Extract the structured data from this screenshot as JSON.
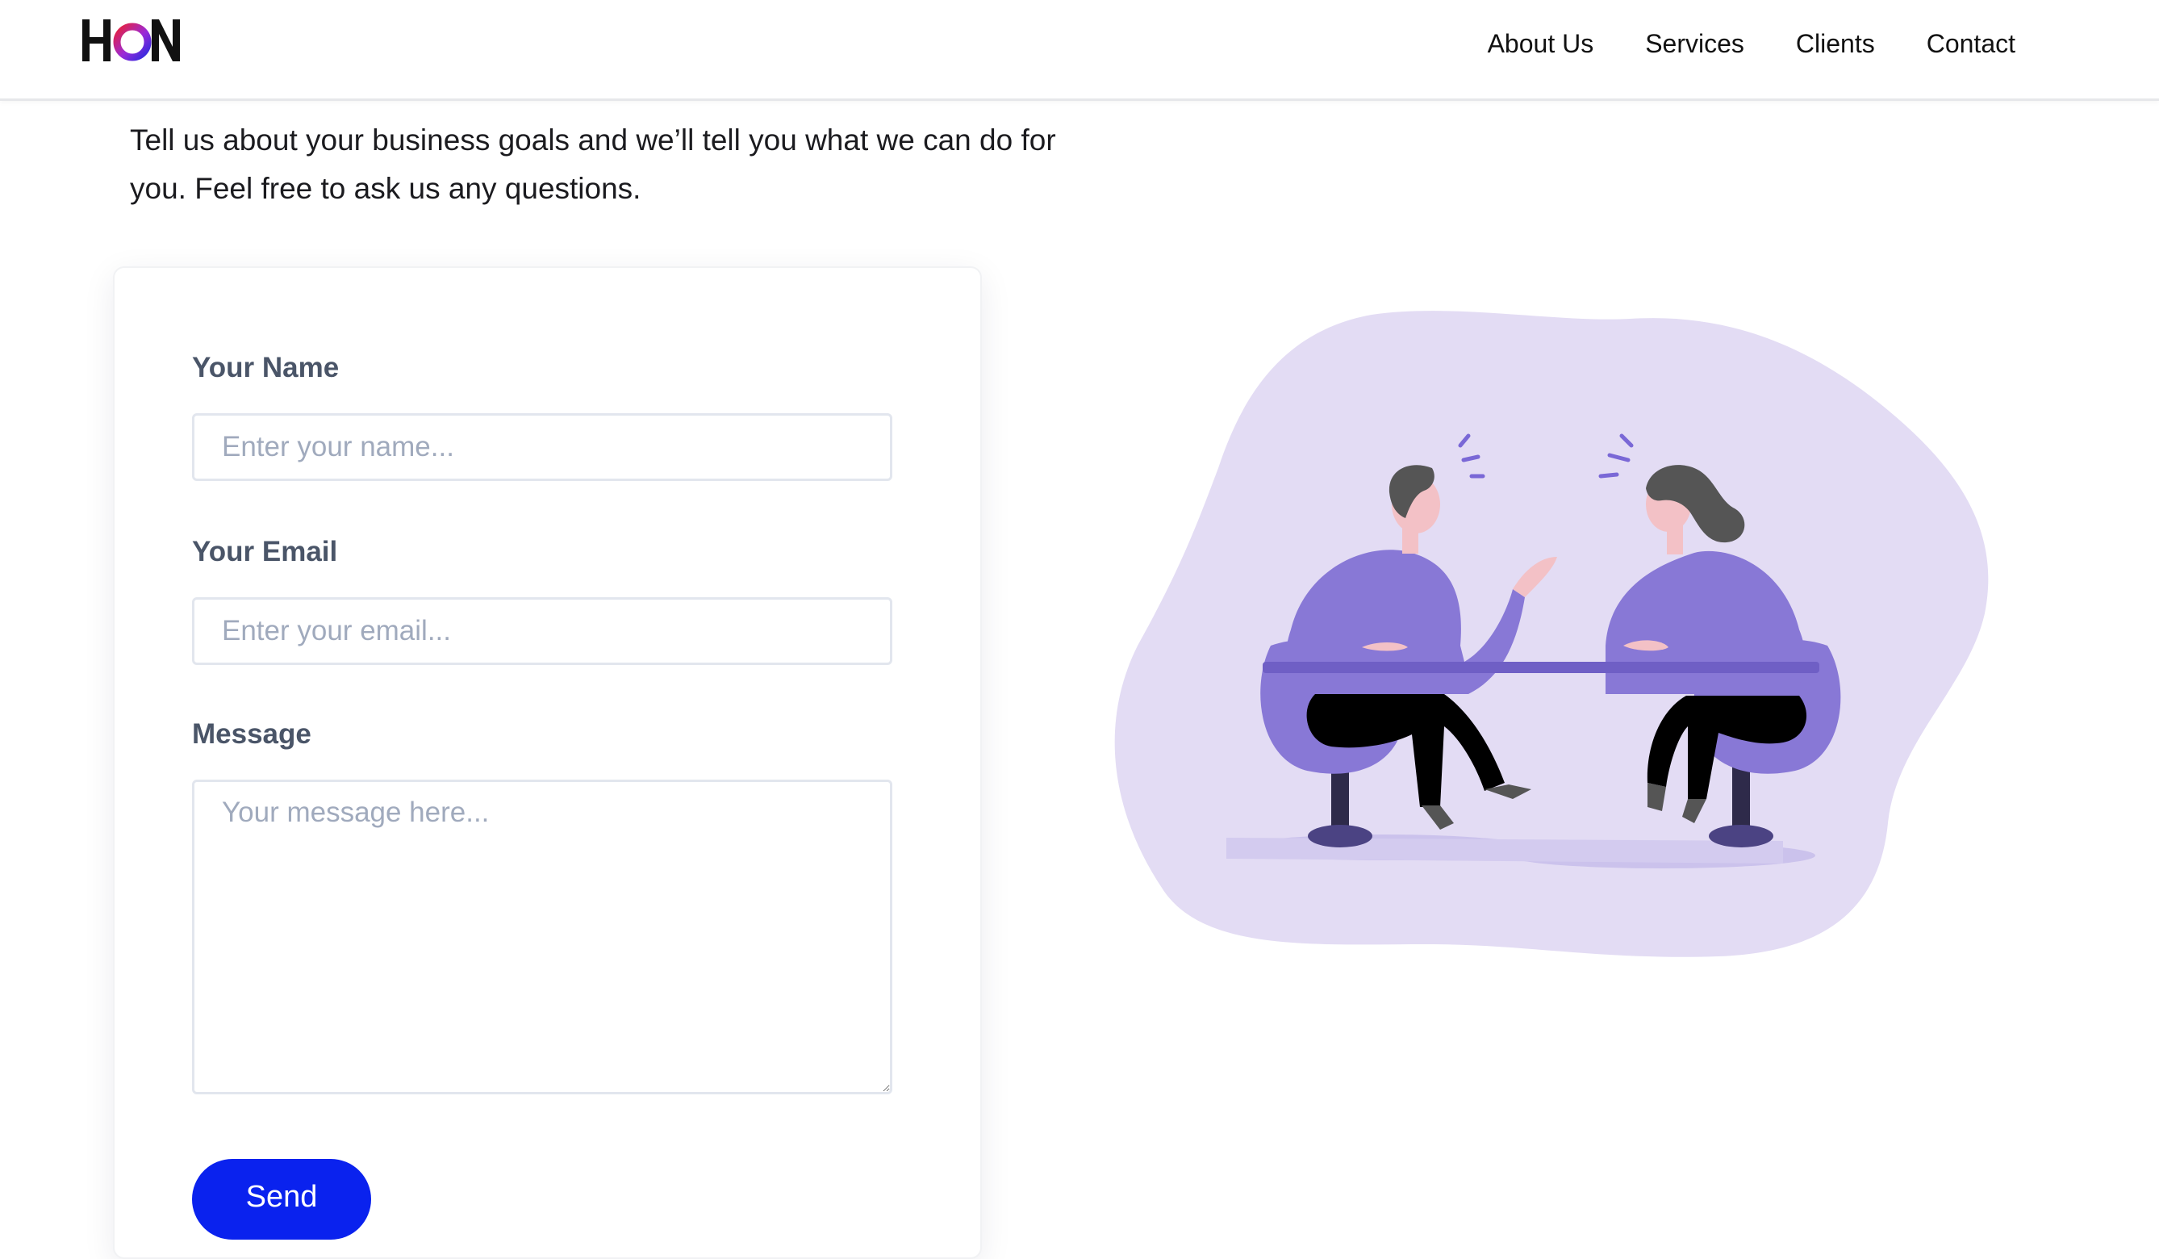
{
  "header": {
    "logo_text": "HON",
    "nav": [
      {
        "label": "About Us"
      },
      {
        "label": "Services"
      },
      {
        "label": "Clients"
      },
      {
        "label": "Contact"
      }
    ]
  },
  "intro": {
    "text": "Tell us about your business goals and we’ll tell you what we can do for you. Feel free to ask us any questions."
  },
  "form": {
    "name_label": "Your Name",
    "name_placeholder": "Enter your name...",
    "name_value": "",
    "email_label": "Your Email",
    "email_placeholder": "Enter your email...",
    "email_value": "",
    "message_label": "Message",
    "message_placeholder": "Your message here...",
    "message_value": "",
    "send_label": "Send"
  },
  "illustration": {
    "name": "two-people-conversation-illustration"
  },
  "colors": {
    "accent_blue": "#0a22ee",
    "illustration_blob": "#e3dcf4",
    "illustration_purple": "#8878d6",
    "logo_red": "#e8203a",
    "logo_blue": "#2a2adf"
  }
}
